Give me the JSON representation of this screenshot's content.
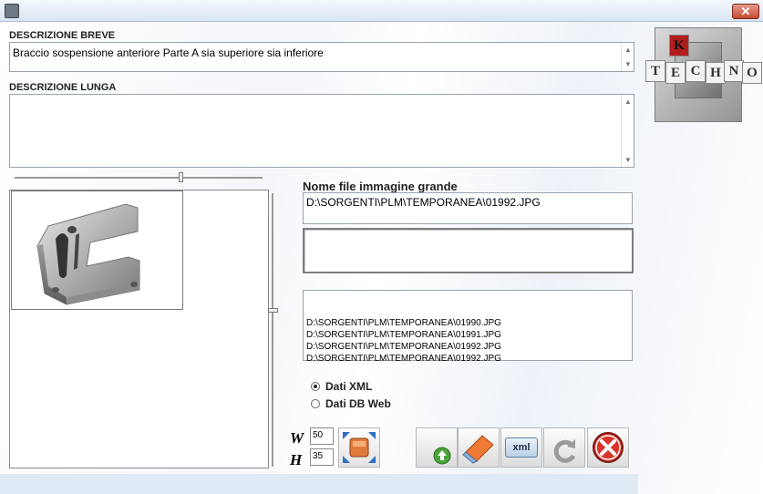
{
  "window": {
    "close_label": "✕"
  },
  "descrizione_breve": {
    "label": "DESCRIZIONE BREVE",
    "value": "Braccio sospensione anteriore Parte A sia superiore sia inferiore"
  },
  "descrizione_lunga": {
    "label": "DESCRIZIONE LUNGA",
    "value": ""
  },
  "image_file": {
    "label": "Nome file immagine grande",
    "value": "D:\\SORGENTI\\PLM\\TEMPORANEA\\01992.JPG"
  },
  "file_list": [
    "D:\\SORGENTI\\PLM\\TEMPORANEA\\01990.JPG",
    "D:\\SORGENTI\\PLM\\TEMPORANEA\\01991.JPG",
    "D:\\SORGENTI\\PLM\\TEMPORANEA\\01992.JPG",
    "D:\\SORGENTI\\PLM\\TEMPORANEA\\01992.JPG"
  ],
  "data_source": {
    "options": [
      {
        "label": "Dati XML",
        "selected": true
      },
      {
        "label": "Dati DB Web",
        "selected": false
      }
    ]
  },
  "size": {
    "w_label": "W",
    "w_value": "50",
    "h_label": "H",
    "h_value": "35"
  },
  "logo": {
    "letters": [
      "K",
      "T",
      "E",
      "C",
      "H",
      "N",
      "O"
    ]
  },
  "toolbar": {
    "icons": [
      "resize-expand-icon",
      "upload-icon",
      "eraser-icon",
      "xml-icon",
      "refresh-icon",
      "cancel-icon"
    ],
    "xml_label": "xml"
  },
  "colors": {
    "accent_red": "#d8352a",
    "eraser_orange": "#f07a33",
    "upload_green": "#4aa53a"
  }
}
